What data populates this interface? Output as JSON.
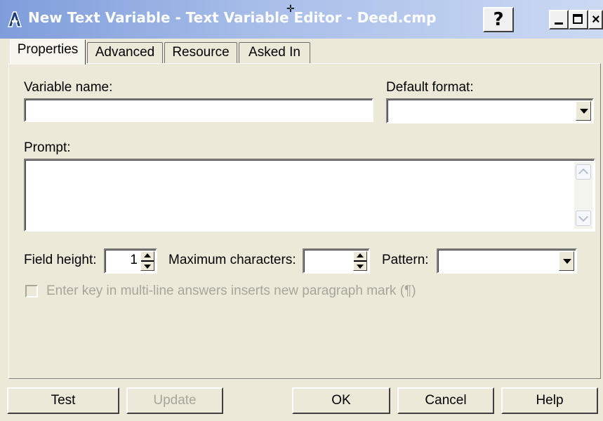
{
  "window": {
    "title": "New Text Variable - Text Variable Editor - Deed.cmp",
    "help_label": "?",
    "close_label": "×"
  },
  "tabs": [
    {
      "label": "Properties",
      "active": true
    },
    {
      "label": "Advanced",
      "active": false
    },
    {
      "label": "Resource",
      "active": false
    },
    {
      "label": "Asked In",
      "active": false
    }
  ],
  "form": {
    "variable_name_label": "Variable name:",
    "variable_name_value": "",
    "default_format_label": "Default format:",
    "default_format_value": "",
    "prompt_label": "Prompt:",
    "prompt_value": "",
    "field_height_label": "Field height:",
    "field_height_value": "1",
    "max_chars_label": "Maximum characters:",
    "max_chars_value": "",
    "pattern_label": "Pattern:",
    "pattern_value": "",
    "enter_key_label": "Enter key in multi-line answers inserts new paragraph mark (¶)",
    "enter_key_checked": false
  },
  "buttons": {
    "test": "Test",
    "update": "Update",
    "ok": "OK",
    "cancel": "Cancel",
    "help": "Help"
  },
  "colors": {
    "title_gradient_start": "#7f9ddb",
    "dialog_bg": "#ece9d8",
    "disabled_text": "#a8a59a"
  }
}
